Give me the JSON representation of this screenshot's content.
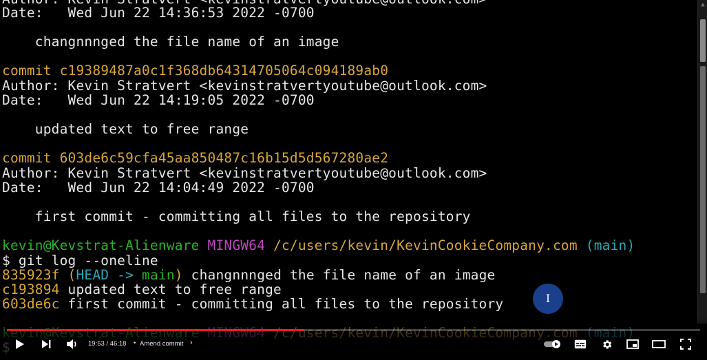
{
  "terminal": {
    "lines": {
      "l0": [
        {
          "t": "Author: Kevin Stratvert <kevinstratvertyoutube@outlook.com>",
          "c": "gry"
        }
      ],
      "l1": [
        {
          "t": "Date:   Wed Jun 22 14:36:53 2022 -0700",
          "c": "gry"
        }
      ],
      "l2": [
        {
          "t": "    changnnnged the file name of an image",
          "c": "gry"
        }
      ],
      "l3": [
        {
          "t": "commit c19389487a0c1f368db64314705064c094189ab0",
          "c": "yel"
        }
      ],
      "l4": [
        {
          "t": "Author: Kevin Stratvert <kevinstratvertyoutube@outlook.com>",
          "c": "gry"
        }
      ],
      "l5": [
        {
          "t": "Date:   Wed Jun 22 14:19:05 2022 -0700",
          "c": "gry"
        }
      ],
      "l6": [
        {
          "t": "    updated text to free range",
          "c": "gry"
        }
      ],
      "l7": [
        {
          "t": "commit 603de6c59cfa45aa850487c16b15d5d567280ae2",
          "c": "yel"
        }
      ],
      "l8": [
        {
          "t": "Author: Kevin Stratvert <kevinstratvertyoutube@outlook.com>",
          "c": "gry"
        }
      ],
      "l9": [
        {
          "t": "Date:   Wed Jun 22 14:04:49 2022 -0700",
          "c": "gry"
        }
      ],
      "l10": [
        {
          "t": "    first commit - committing all files to the repository",
          "c": "gry"
        }
      ],
      "l11": [
        {
          "t": "kevin@Kevstrat-Alienware ",
          "c": "grn"
        },
        {
          "t": "MINGW64 ",
          "c": "mag"
        },
        {
          "t": "/c/users/kevin/KevinCookieCompany.com ",
          "c": "yel"
        },
        {
          "t": "(main)",
          "c": "cyn"
        }
      ],
      "l12": [
        {
          "t": "$ git log --oneline",
          "c": "gry"
        }
      ],
      "l13": [
        {
          "t": "835923f ",
          "c": "yel"
        },
        {
          "t": "(",
          "c": "yel"
        },
        {
          "t": "HEAD -> ",
          "c": "cyn"
        },
        {
          "t": "main",
          "c": "grn"
        },
        {
          "t": ")",
          "c": "yel"
        },
        {
          "t": " changnnnged the file name of an image",
          "c": "gry"
        }
      ],
      "l14": [
        {
          "t": "c193894 ",
          "c": "yel"
        },
        {
          "t": "updated text to free range",
          "c": "gry"
        }
      ],
      "l15": [
        {
          "t": "603de6c ",
          "c": "yel"
        },
        {
          "t": "first commit - committing all files to the repository",
          "c": "gry"
        }
      ],
      "l16": [
        {
          "t": "kevin@Kevstrat-Alienware ",
          "c": "grn"
        },
        {
          "t": "MINGW64 ",
          "c": "mag"
        },
        {
          "t": "/c/users/kevin/KevinCookieCompany.com ",
          "c": "yel"
        },
        {
          "t": "(main)",
          "c": "cyn"
        }
      ],
      "l17": [
        {
          "t": "$",
          "c": "gry"
        }
      ]
    }
  },
  "cursor_overlay": {
    "glyph": "I"
  },
  "player": {
    "time_display": "19:53 / 46:18",
    "separator": "•",
    "chapter_title": "Amend commit",
    "chapter_chevron": "›",
    "progress_fraction": 0.4294,
    "progress_color": "#e62117",
    "icons": [
      "play-icon",
      "next-icon",
      "volume-icon",
      "autoplay-toggle-icon",
      "subtitles-icon",
      "settings-icon",
      "miniplayer-icon",
      "theater-mode-icon",
      "fullscreen-icon"
    ]
  },
  "colors": {
    "background": "#000000",
    "text": "#e6e6e6",
    "commit_hash": "#d8a63a",
    "prompt_user": "#28b328",
    "prompt_env": "#c046c0",
    "branch": "#28a8b8"
  }
}
